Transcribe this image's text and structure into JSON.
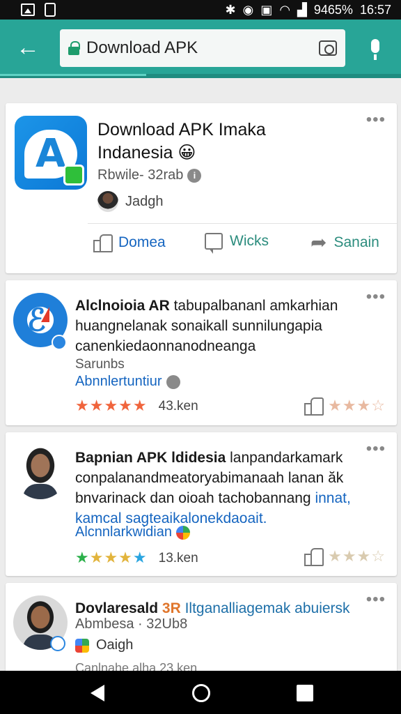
{
  "status_bar": {
    "battery": "9465%",
    "time": "16:57"
  },
  "toolbar": {
    "search_value": "Download APK"
  },
  "top_result": {
    "title_line1": "Download APK Imaka",
    "title_line2": "Indanesia 😀",
    "meta": "Rbwile- 32rab",
    "author": "Jadgh",
    "actions": {
      "like": "Domea",
      "comment": "Wicks",
      "share": "Sanain"
    }
  },
  "results": [
    {
      "title": "Alclnoioia AR",
      "text1": " tabupalbananl amkarhian",
      "text2": "huangnelanak sonaikall sunnilungapia",
      "text3": "canenkiedaonnanodneanga",
      "source": "Sarunbs",
      "site": "Abnnlertuntiur",
      "rating_stars": "★★★★★",
      "rating_color": "#f05a3c",
      "count": "43.ken",
      "vote_stars": "★★★☆"
    },
    {
      "title": "Bapnian APK ldidesia",
      "text1": " lanpandarkamark",
      "text2": "conpalanandmeatoryabimanaah lanan ăk",
      "text3": "bnvarinack dan oioah tachobannang ",
      "text3_link": "innat,",
      "text4": "kamcal sagteaikalonekdaoait.",
      "site": "Alcnnlarkwidian",
      "rating_stars": "★★★★★",
      "count": "13.ken",
      "vote_stars": "★★★☆"
    },
    {
      "title": "Dovlaresald",
      "title_accent": " 3R",
      "title_rest": " Iltganalliagemak abuiersk",
      "meta": "Abmbesa · 32Ub8",
      "author": "Oaigh",
      "teaser": "Canlnahe alha 23 ken"
    }
  ],
  "colors": {
    "toolbar": "#28a597",
    "link": "#1565c0",
    "accent_green": "#1e9c6c"
  },
  "icons": [
    "image-icon",
    "phone-icon",
    "bluetooth-icon",
    "wifi-icon",
    "signal-icon",
    "back-arrow-icon",
    "lock-icon",
    "camera-icon",
    "mic-icon",
    "more-icon",
    "thumbs-up-icon",
    "comment-icon",
    "share-icon",
    "star-icon"
  ]
}
